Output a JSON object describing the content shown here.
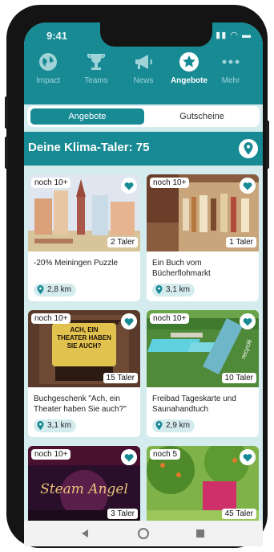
{
  "status": {
    "time": "9:41",
    "signal": "▮▮ ◠ ▬"
  },
  "nav": {
    "items": [
      {
        "label": "Impact",
        "icon": "globe-icon"
      },
      {
        "label": "Teams",
        "icon": "trophy-icon"
      },
      {
        "label": "News",
        "icon": "megaphone-icon"
      },
      {
        "label": "Angebote",
        "icon": "star-badge-icon"
      },
      {
        "label": "Mehr",
        "icon": "more-dots-icon"
      }
    ],
    "active": "Angebote"
  },
  "segmented": {
    "left": "Angebote",
    "right": "Gutscheine",
    "selected": "Angebote"
  },
  "header": {
    "title": "Deine Klima-Taler: 75",
    "icon": "location-pin-icon"
  },
  "cards": [
    {
      "badge": "noch 10+",
      "price": "2 Taler",
      "title": "-20% Meiningen Puzzle",
      "distance": "2,8 km"
    },
    {
      "badge": "noch 10+",
      "price": "1 Taler",
      "title": "Ein Buch vom Bücherflohmarkt",
      "distance": "3,1 km"
    },
    {
      "badge": "noch 10+",
      "price": "15 Taler",
      "title": "Buchgeschenk \"Ach, ein Theater haben Sie auch?\"",
      "distance": "3,1 km",
      "image_text": "ACH, EIN THEATER HABEN SIE AUCH?"
    },
    {
      "badge": "noch 10+",
      "price": "10 Taler",
      "title": "Freibad Tageskarte und Saunahandtuch",
      "distance": "2,9 km",
      "image_text": "recyclé"
    },
    {
      "badge": "noch 10+",
      "price": "3 Taler",
      "title": "",
      "distance": "",
      "image_text": "Steam Angel"
    },
    {
      "badge": "noch 5",
      "price": "45 Taler",
      "title": "",
      "distance": ""
    }
  ],
  "colors": {
    "primary": "#178a94",
    "background": "#d5ecef"
  }
}
